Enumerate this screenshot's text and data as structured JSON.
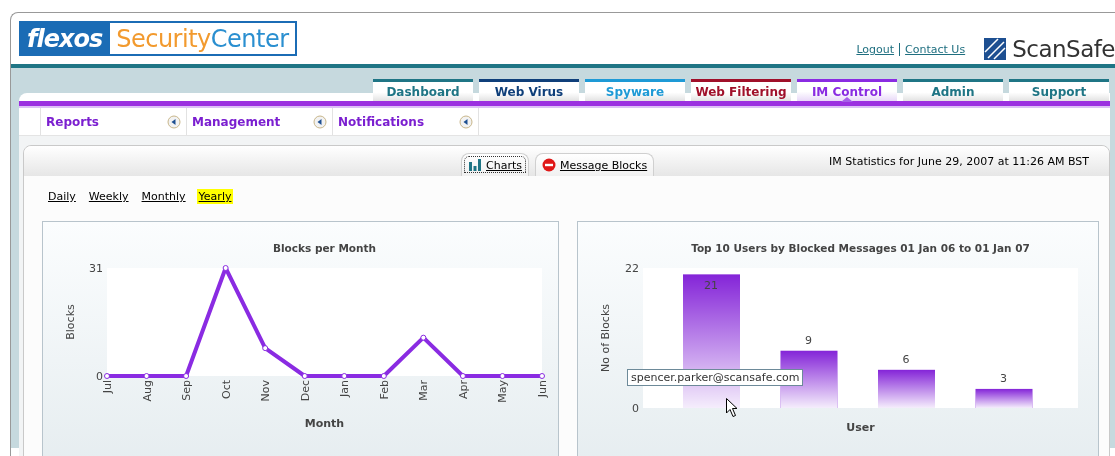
{
  "header": {
    "brand": "flexos",
    "product_first": "Security",
    "product_second": "Center",
    "links": [
      "Logout",
      "Contact Us"
    ],
    "vendor": "ScanSafe"
  },
  "tabs": [
    {
      "label": "Dashboard",
      "color": "#1f7585",
      "selected": false
    },
    {
      "label": "Web Virus",
      "color": "#0f3f7a",
      "selected": false
    },
    {
      "label": "Spyware",
      "color": "#1e9ad6",
      "selected": false
    },
    {
      "label": "Web Filtering",
      "color": "#a0102a",
      "selected": false
    },
    {
      "label": "IM Control",
      "color": "#8a2be2",
      "selected": true
    },
    {
      "label": "Admin",
      "color": "#1f7585",
      "selected": false
    },
    {
      "label": "Support",
      "color": "#1f7585",
      "selected": false
    }
  ],
  "subnav": [
    {
      "label": "Reports"
    },
    {
      "label": "Management"
    },
    {
      "label": "Notifications"
    }
  ],
  "view_tabs": [
    {
      "label": "Charts",
      "kind": "chart",
      "selected": true
    },
    {
      "label": "Message Blocks",
      "kind": "block",
      "selected": false
    }
  ],
  "timestamp": "IM Statistics for June 29, 2007 at 11:26 AM BST",
  "periods": [
    {
      "label": "Daily",
      "selected": false
    },
    {
      "label": "Weekly",
      "selected": false
    },
    {
      "label": "Monthly",
      "selected": false
    },
    {
      "label": "Yearly",
      "selected": true
    }
  ],
  "charts": [
    {
      "chart_data": {
        "type": "line",
        "title": "Blocks per Month",
        "xlabel": "Month",
        "ylabel": "Blocks",
        "categories": [
          "Jul",
          "Aug",
          "Sep",
          "Oct",
          "Nov",
          "Dec",
          "Jan",
          "Feb",
          "Mar",
          "Apr",
          "May",
          "Jun"
        ],
        "ylim": [
          0,
          31
        ],
        "yticks": [
          0,
          31
        ],
        "series": [
          {
            "color": "#8a2be2",
            "marker": true,
            "values": [
              0,
              0,
              0,
              31,
              8,
              0,
              0,
              0,
              11,
              0,
              0,
              0
            ]
          }
        ]
      }
    },
    {
      "chart_data": {
        "type": "bar",
        "title": "Top 10 Users by Blocked Messages 01 Jan 06 to 01 Jan 07",
        "xlabel": "User",
        "ylabel": "No of Blocks",
        "categories": [
          null,
          null,
          null,
          null
        ],
        "ylim": [
          0,
          22
        ],
        "yticks": [
          0,
          22
        ],
        "data_labels": true,
        "series": [
          {
            "color": "#8424d8",
            "values": [
              21,
              9,
              6,
              3
            ]
          }
        ]
      },
      "tooltip": "spencer.parker@scansafe.com"
    }
  ]
}
